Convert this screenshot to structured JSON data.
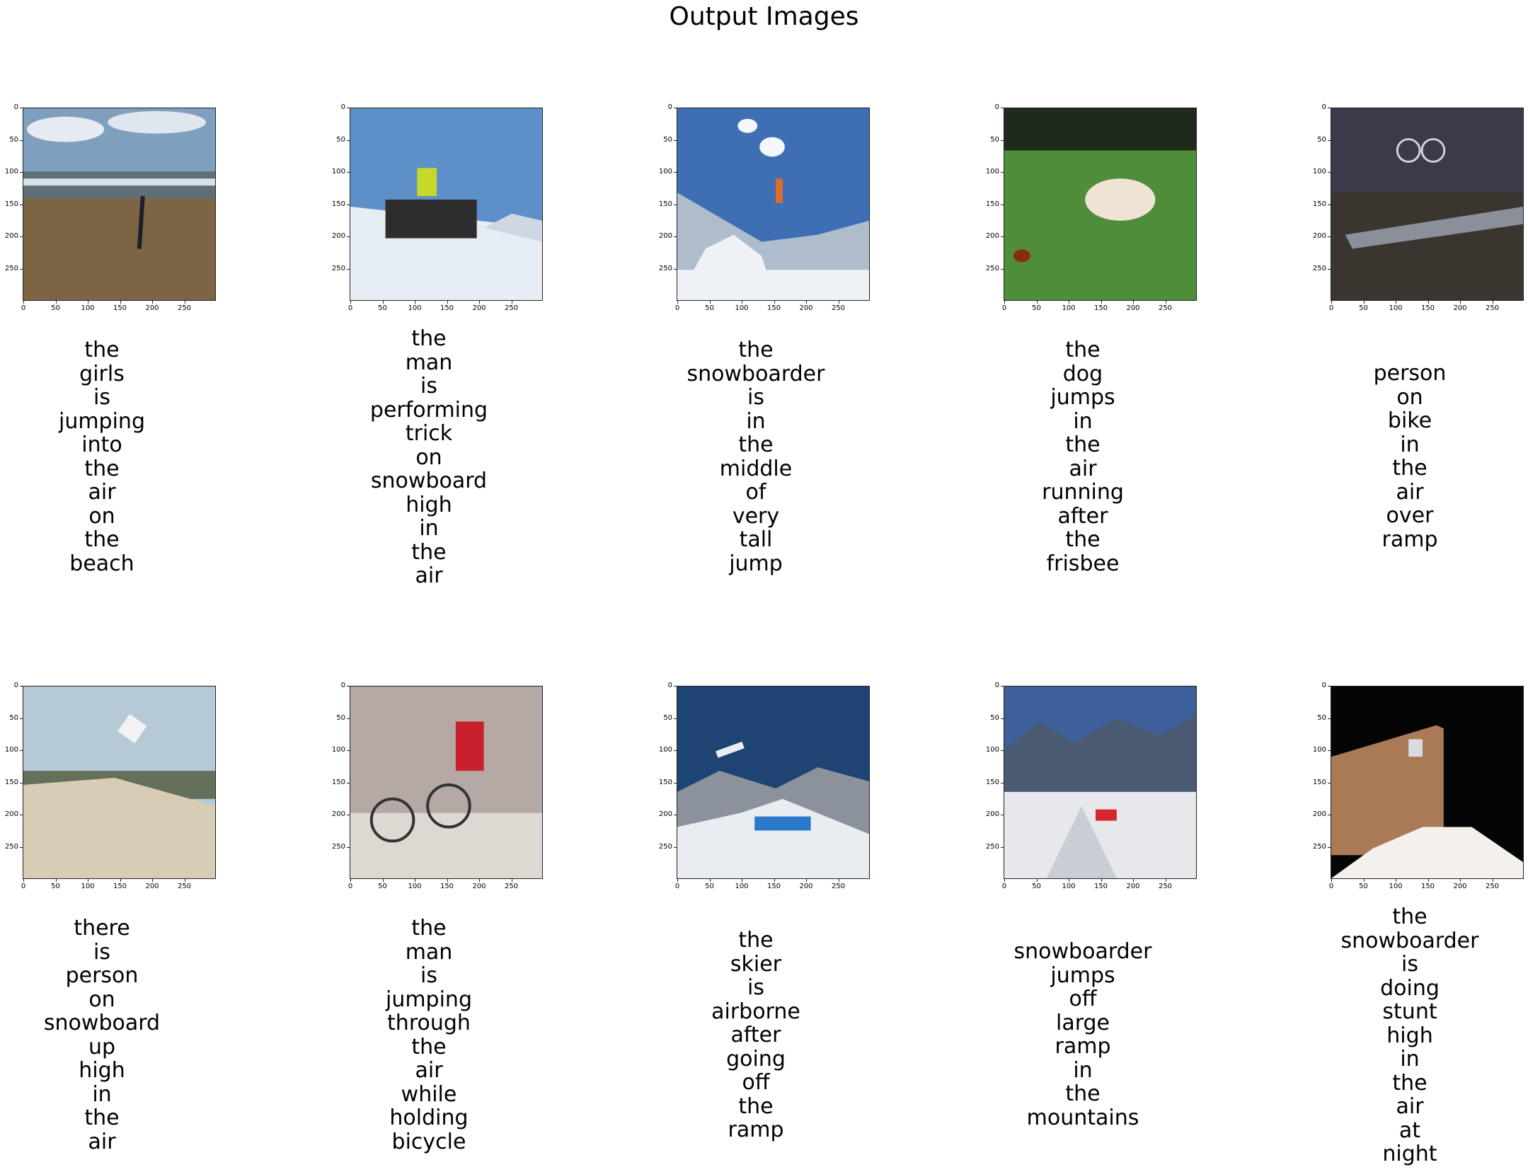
{
  "title": "Output Images",
  "axis": {
    "y_ticks": [
      "0",
      "50",
      "100",
      "150",
      "200",
      "250"
    ],
    "x_ticks": [
      "0",
      "50",
      "100",
      "150",
      "200",
      "250"
    ]
  },
  "panels": [
    {
      "scene": "beach-photo",
      "colors": {
        "sky": "#7f9fbf",
        "ground": "#7c6444",
        "accent": "#d9e1e8"
      },
      "caption": [
        "the",
        "girls",
        "is",
        "jumping",
        "into",
        "the",
        "air",
        "on",
        "the",
        "beach"
      ]
    },
    {
      "scene": "snowboard-rail-photo",
      "colors": {
        "sky": "#5d8fc8",
        "ground": "#e7edf4",
        "accent": "#c6d82a"
      },
      "caption": [
        "the",
        "man",
        "is",
        "performing",
        "trick",
        "on",
        "snowboard",
        "high",
        "in",
        "the",
        "air"
      ]
    },
    {
      "scene": "snowboard-jump-photo",
      "colors": {
        "sky": "#3e6fb4",
        "ground": "#eef2f6",
        "accent": "#e06a2a"
      },
      "caption": [
        "the",
        "snowboarder",
        "is",
        "in",
        "the",
        "middle",
        "of",
        "very",
        "tall",
        "jump"
      ]
    },
    {
      "scene": "dog-frisbee-photo",
      "colors": {
        "sky": "#1f2a1c",
        "ground": "#4f8d3a",
        "accent": "#efe3d6"
      },
      "caption": [
        "the",
        "dog",
        "jumps",
        "in",
        "the",
        "air",
        "running",
        "after",
        "the",
        "frisbee"
      ]
    },
    {
      "scene": "bmx-ramp-photo",
      "colors": {
        "sky": "#3a3a4a",
        "ground": "#3b3530",
        "accent": "#8a8f99"
      },
      "caption": [
        "person",
        "on",
        "bike",
        "in",
        "the",
        "air",
        "over",
        "ramp"
      ]
    },
    {
      "scene": "snowboard-dune-photo",
      "colors": {
        "sky": "#b6c9d6",
        "ground": "#d8cdb4",
        "accent": "#f2f2f2"
      },
      "caption": [
        "there",
        "is",
        "person",
        "on",
        "snowboard",
        "up",
        "high",
        "in",
        "the",
        "air"
      ]
    },
    {
      "scene": "cyclocross-photo",
      "colors": {
        "sky": "#b4a9a4",
        "ground": "#ded8d2",
        "accent": "#c8212b"
      },
      "caption": [
        "the",
        "man",
        "is",
        "jumping",
        "through",
        "the",
        "air",
        "while",
        "holding",
        "bicycle"
      ]
    },
    {
      "scene": "ski-jump-photo",
      "colors": {
        "sky": "#1e4473",
        "ground": "#e9edf1",
        "accent": "#2a78c9"
      },
      "caption": [
        "the",
        "skier",
        "is",
        "airborne",
        "after",
        "going",
        "off",
        "the",
        "ramp"
      ]
    },
    {
      "scene": "mountain-ramp-photo",
      "colors": {
        "sky": "#3d5f9a",
        "ground": "#e6e8ec",
        "accent": "#d4262b"
      },
      "caption": [
        "snowboarder",
        "jumps",
        "off",
        "large",
        "ramp",
        "in",
        "the",
        "mountains"
      ]
    },
    {
      "scene": "night-wall-photo",
      "colors": {
        "sky": "#050505",
        "ground": "#a97a55",
        "accent": "#f4f1ec"
      },
      "caption": [
        "the",
        "snowboarder",
        "is",
        "doing",
        "stunt",
        "high",
        "in",
        "the",
        "air",
        "at",
        "night"
      ]
    }
  ]
}
